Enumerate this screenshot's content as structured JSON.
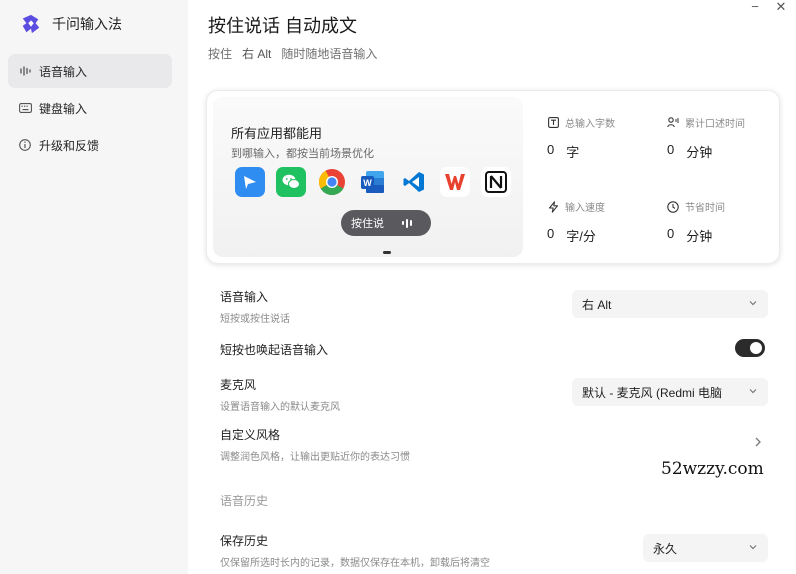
{
  "app": {
    "title": "千问输入法"
  },
  "sidebar": {
    "items": [
      {
        "label": "语音输入",
        "icon": "voice-wave-icon"
      },
      {
        "label": "键盘输入",
        "icon": "keyboard-icon"
      },
      {
        "label": "升级和反馈",
        "icon": "info-icon"
      }
    ]
  },
  "window": {
    "minimize": "−",
    "close": "✕"
  },
  "header": {
    "title": "按住说话 自动成文",
    "subtitle": [
      "按住",
      "右 Alt",
      "随时随地语音输入"
    ]
  },
  "promo": {
    "title": "所有应用都能用",
    "subtitle": "到哪输入，都按当前场景优化",
    "apps": [
      "feishu-app-icon",
      "wechat-app-icon",
      "chrome-app-icon",
      "word-app-icon",
      "vscode-app-icon",
      "wps-app-icon",
      "notion-app-icon"
    ],
    "hold_label": "按住说"
  },
  "stats": [
    {
      "label": "总输入字数",
      "value": "0",
      "unit": "字",
      "icon": "text-box-icon"
    },
    {
      "label": "累计口述时间",
      "value": "0",
      "unit": "分钟",
      "icon": "voice-user-icon"
    },
    {
      "label": "输入速度",
      "value": "0",
      "unit": "字/分",
      "icon": "lightning-icon"
    },
    {
      "label": "节省时间",
      "value": "0",
      "unit": "分钟",
      "icon": "clock-icon"
    }
  ],
  "settings": {
    "voice_input": {
      "label": "语音输入",
      "desc": "短按或按住说话",
      "value": "右 Alt"
    },
    "short_press": {
      "label": "短按也唤起语音输入",
      "enabled": true
    },
    "microphone": {
      "label": "麦克风",
      "desc": "设置语音输入的默认麦克风",
      "value": "默认 - 麦克风 (Redmi 电脑"
    },
    "custom_style": {
      "label": "自定义风格",
      "desc": "调整润色风格，让输出更贴近你的表达习惯"
    },
    "history_section": "语音历史",
    "save_history": {
      "label": "保存历史",
      "desc": "仅保留所选时长内的记录，数据仅保存在本机，卸载后将清空",
      "value": "永久"
    }
  },
  "watermark": "52wzzy.com"
}
